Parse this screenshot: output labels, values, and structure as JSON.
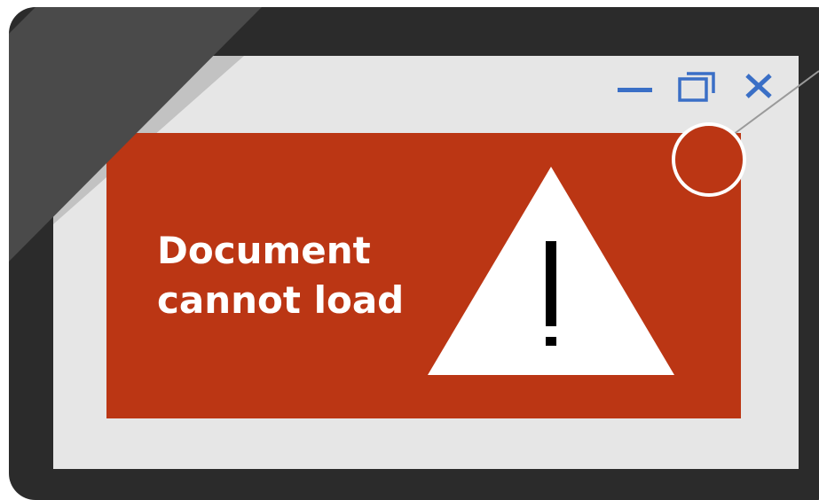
{
  "window_controls": {
    "minimize_icon": "minimize-icon",
    "restore_icon": "restore-icon",
    "close_icon": "close-icon",
    "icon_color": "#3a6fc6"
  },
  "error": {
    "line1": "Document",
    "line2": "cannot load",
    "panel_color": "#bb3614",
    "text_color": "#ffffff",
    "icon": "warning-triangle-icon"
  },
  "callout": {
    "icon": "callout-circle",
    "color": "#bb3614"
  },
  "device": {
    "bezel_color": "#2b2b2b",
    "screen_color": "#e6e6e6"
  }
}
